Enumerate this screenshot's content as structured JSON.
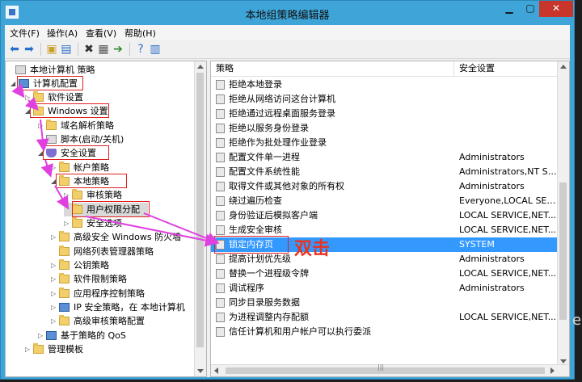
{
  "window": {
    "title": "本地组策略编辑器",
    "min_label": "▁",
    "max_label": "▢",
    "close_label": "✕"
  },
  "menubar": {
    "items": [
      "文件(F)",
      "操作(A)",
      "查看(V)",
      "帮助(H)"
    ]
  },
  "tree": {
    "items": [
      {
        "label": "本地计算机 策略",
        "icon": "policy-icon",
        "expander": ""
      },
      {
        "label": "计算机配置",
        "icon": "computer-icon",
        "expander": "◢"
      },
      {
        "label": "软件设置",
        "icon": "folder-icon",
        "expander": "▷"
      },
      {
        "label": "Windows 设置",
        "icon": "folder-icon",
        "expander": "◢"
      },
      {
        "label": "域名解析策略",
        "icon": "folder-icon",
        "expander": "▷"
      },
      {
        "label": "脚本(启动/关机)",
        "icon": "script-icon",
        "expander": ""
      },
      {
        "label": "安全设置",
        "icon": "shield-icon",
        "expander": "◢"
      },
      {
        "label": "帐户策略",
        "icon": "folder-icon",
        "expander": "▷"
      },
      {
        "label": "本地策略",
        "icon": "folder-icon",
        "expander": "◢"
      },
      {
        "label": "审核策略",
        "icon": "folder-icon",
        "expander": "▷"
      },
      {
        "label": "用户权限分配",
        "icon": "folder-icon",
        "expander": ""
      },
      {
        "label": "安全选项",
        "icon": "folder-icon",
        "expander": "▷"
      },
      {
        "label": "高级安全 Windows 防火墙",
        "icon": "folder-icon",
        "expander": "▷"
      },
      {
        "label": "网络列表管理器策略",
        "icon": "folder-icon",
        "expander": ""
      },
      {
        "label": "公钥策略",
        "icon": "folder-icon",
        "expander": "▷"
      },
      {
        "label": "软件限制策略",
        "icon": "folder-icon",
        "expander": "▷"
      },
      {
        "label": "应用程序控制策略",
        "icon": "folder-icon",
        "expander": "▷"
      },
      {
        "label": "IP 安全策略，在 本地计算机",
        "icon": "ipsec-icon",
        "expander": "▷"
      },
      {
        "label": "高级审核策略配置",
        "icon": "folder-icon",
        "expander": "▷"
      },
      {
        "label": "基于策略的 QoS",
        "icon": "chart-icon",
        "expander": "▷"
      },
      {
        "label": "管理模板",
        "icon": "folder-icon",
        "expander": "▷"
      }
    ]
  },
  "list": {
    "columns": [
      "策略",
      "安全设置"
    ],
    "rows": [
      {
        "name": "拒绝本地登录",
        "value": ""
      },
      {
        "name": "拒绝从网络访问这台计算机",
        "value": ""
      },
      {
        "name": "拒绝通过远程桌面服务登录",
        "value": ""
      },
      {
        "name": "拒绝以服务身份登录",
        "value": ""
      },
      {
        "name": "拒绝作为批处理作业登录",
        "value": ""
      },
      {
        "name": "配置文件单一进程",
        "value": "Administrators"
      },
      {
        "name": "配置文件系统性能",
        "value": "Administrators,NT SE..."
      },
      {
        "name": "取得文件或其他对象的所有权",
        "value": "Administrators"
      },
      {
        "name": "绕过遍历检查",
        "value": "Everyone,LOCAL SERV..."
      },
      {
        "name": "身份验证后模拟客户端",
        "value": "LOCAL SERVICE,NET..."
      },
      {
        "name": "生成安全审核",
        "value": "LOCAL SERVICE,NET..."
      },
      {
        "name": "锁定内存页",
        "value": "SYSTEM"
      },
      {
        "name": "提高计划优先级",
        "value": "Administrators"
      },
      {
        "name": "替换一个进程级令牌",
        "value": "LOCAL SERVICE,NET..."
      },
      {
        "name": "调试程序",
        "value": "Administrators"
      },
      {
        "name": "同步目录服务数据",
        "value": ""
      },
      {
        "name": "为进程调整内存配额",
        "value": "LOCAL SERVICE,NET..."
      },
      {
        "name": "信任计算机和用户帐户可以执行委派",
        "value": ""
      }
    ],
    "selected_index": 11
  },
  "annotation": {
    "text": "双击",
    "color": "#e8331f"
  },
  "side_text": "e",
  "colors": {
    "title_bar": "#3fa5d8",
    "selection": "#3399ff",
    "highlight_box": "#e02020",
    "arrow": "#e040e0"
  }
}
